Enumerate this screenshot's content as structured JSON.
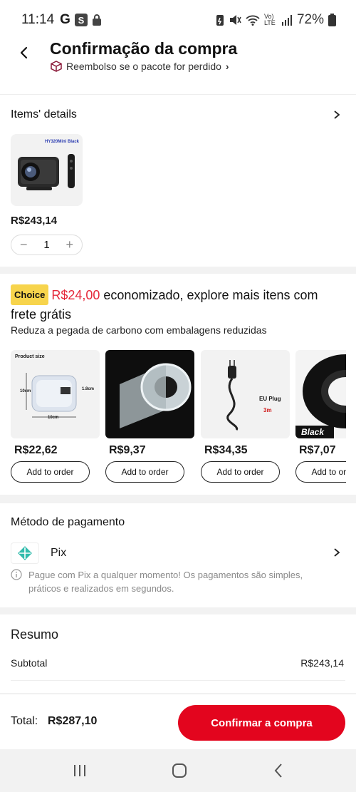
{
  "status_bar": {
    "time": "11:14",
    "g": "G",
    "s": "S",
    "network": "Vo) LTE",
    "battery": "72%"
  },
  "header": {
    "title": "Confirmação da compra",
    "refund_text": "Reembolso se o pacote for perdido",
    "refund_chevron": "›"
  },
  "items": {
    "section_title": "Items' details",
    "product_tag": "HY320Mini Black",
    "price": "R$243,14",
    "qty_minus": "−",
    "quantity": "1",
    "qty_plus": "+"
  },
  "choice": {
    "badge": "Choice",
    "amount": "R$24,00",
    "rest": " economizado, explore mais itens com frete grátis",
    "carbon": "Reduza a pegada de carbono com embalagens reduzidas",
    "add_label": "Add to order",
    "recommendations": [
      {
        "price": "R$22,62",
        "img_text_a": "Product size",
        "img_text_b": "10cm",
        "img_text_c": "1.8cm",
        "img_text_d": "10cm"
      },
      {
        "price": "R$9,37"
      },
      {
        "price": "R$34,35",
        "img_text_a": "EU Plug",
        "img_text_b": "3m"
      },
      {
        "price": "R$7,07",
        "img_text_a": "Black"
      }
    ]
  },
  "payment": {
    "section_title": "Método de pagamento",
    "method": "Pix",
    "note": "Pague com Pix a qualquer momento! Os pagamentos são simples, práticos e realizados em segundos."
  },
  "summary": {
    "title": "Resumo",
    "subtotal_label": "Subtotal",
    "subtotal_value": "R$243,14"
  },
  "footer": {
    "total_label": "Total:",
    "total_value": "R$287,10",
    "confirm_label": "Confirmar a compra"
  },
  "colors": {
    "accent": "#e3051e",
    "choice_yellow": "#f7d44c",
    "pix_teal": "#32bcad"
  }
}
